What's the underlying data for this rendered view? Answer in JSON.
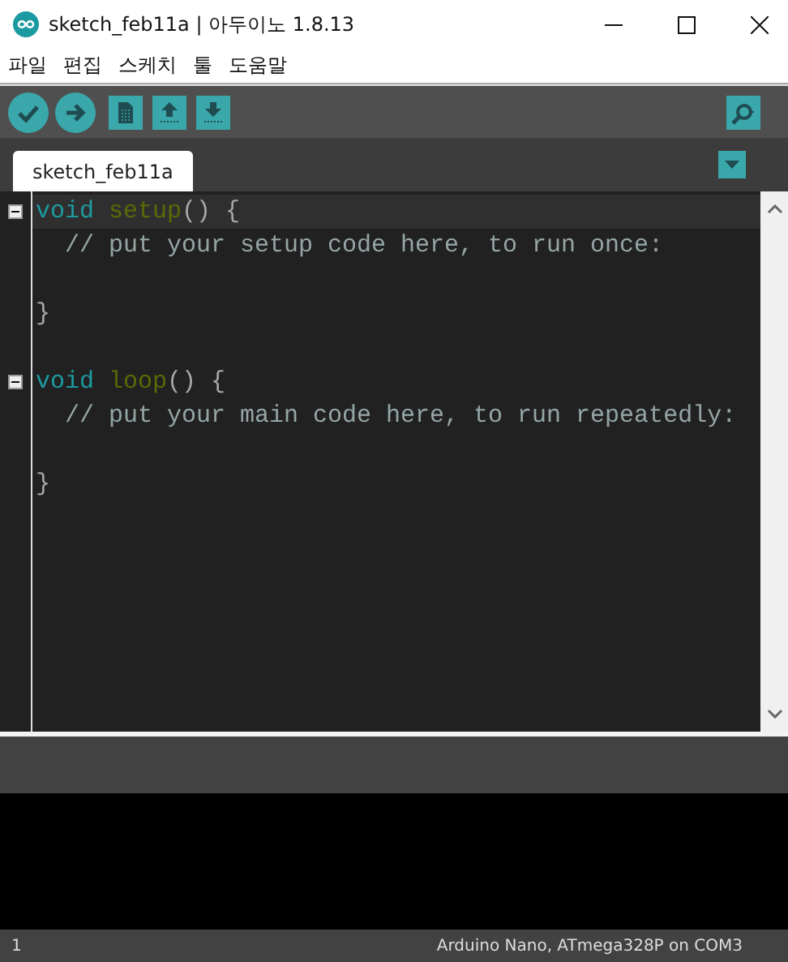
{
  "window": {
    "title": "sketch_feb11a | 아두이노 1.8.13"
  },
  "menu": [
    {
      "label": "파일"
    },
    {
      "label": "편집"
    },
    {
      "label": "스케치"
    },
    {
      "label": "툴"
    },
    {
      "label": "도움말"
    }
  ],
  "tabs": [
    {
      "label": "sketch_feb11a",
      "selected": true
    }
  ],
  "editor": {
    "lines": [
      {
        "current": true,
        "foldable": true,
        "tokens": [
          {
            "kind": "keyword",
            "text": "void "
          },
          {
            "kind": "function",
            "text": "setup"
          },
          {
            "kind": "plain",
            "text": "() {"
          }
        ]
      },
      {
        "current": false,
        "foldable": false,
        "tokens": [
          {
            "kind": "comment",
            "text": "  // put your setup code here, to run once:"
          }
        ]
      },
      {
        "current": false,
        "foldable": false
      },
      {
        "current": false,
        "foldable": false,
        "tokens": [
          {
            "kind": "plain",
            "text": "}"
          }
        ]
      },
      {
        "current": false,
        "foldable": false
      },
      {
        "current": false,
        "foldable": true,
        "tokens": [
          {
            "kind": "keyword",
            "text": "void "
          },
          {
            "kind": "function",
            "text": "loop"
          },
          {
            "kind": "plain",
            "text": "() {"
          }
        ]
      },
      {
        "current": false,
        "foldable": false,
        "tokens": [
          {
            "kind": "comment",
            "text": "  // put your main code here, to run repeatedly:"
          }
        ]
      },
      {
        "current": false,
        "foldable": false
      },
      {
        "current": false,
        "foldable": false,
        "tokens": [
          {
            "kind": "plain",
            "text": "}"
          }
        ]
      }
    ]
  },
  "status_bar": {
    "line": "1",
    "board": "Arduino Nano, ATmega328P on COM3"
  }
}
